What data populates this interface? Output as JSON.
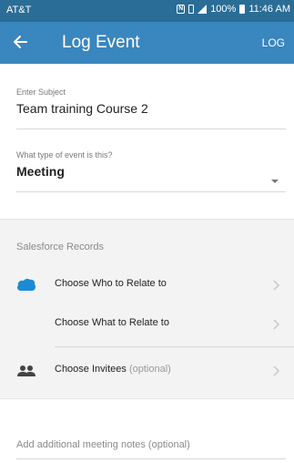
{
  "status_bar": {
    "carrier": "AT&T",
    "battery": "100%",
    "time": "11:46 AM",
    "icons": [
      "nfc-icon",
      "vibrate-icon",
      "signal-icon",
      "battery-icon"
    ]
  },
  "app_bar": {
    "title": "Log Event",
    "action_label": "LOG",
    "back_icon": "arrow-left-icon",
    "color": "#3a86bf"
  },
  "form": {
    "subject": {
      "label": "Enter Subject",
      "value": "Team training Course 2"
    },
    "event_type": {
      "label": "What type of event is this?",
      "value": "Meeting"
    }
  },
  "records": {
    "header": "Salesforce Records",
    "rows": [
      {
        "label": "Choose Who to Relate to",
        "icon": "salesforce-cloud-icon"
      },
      {
        "label": "Choose What to Relate to",
        "icon": ""
      },
      {
        "label": "Choose Invitees",
        "optional": "(optional)",
        "icon": "people-icon"
      }
    ]
  },
  "notes": {
    "placeholder": "Add additional meeting notes (optional)"
  }
}
